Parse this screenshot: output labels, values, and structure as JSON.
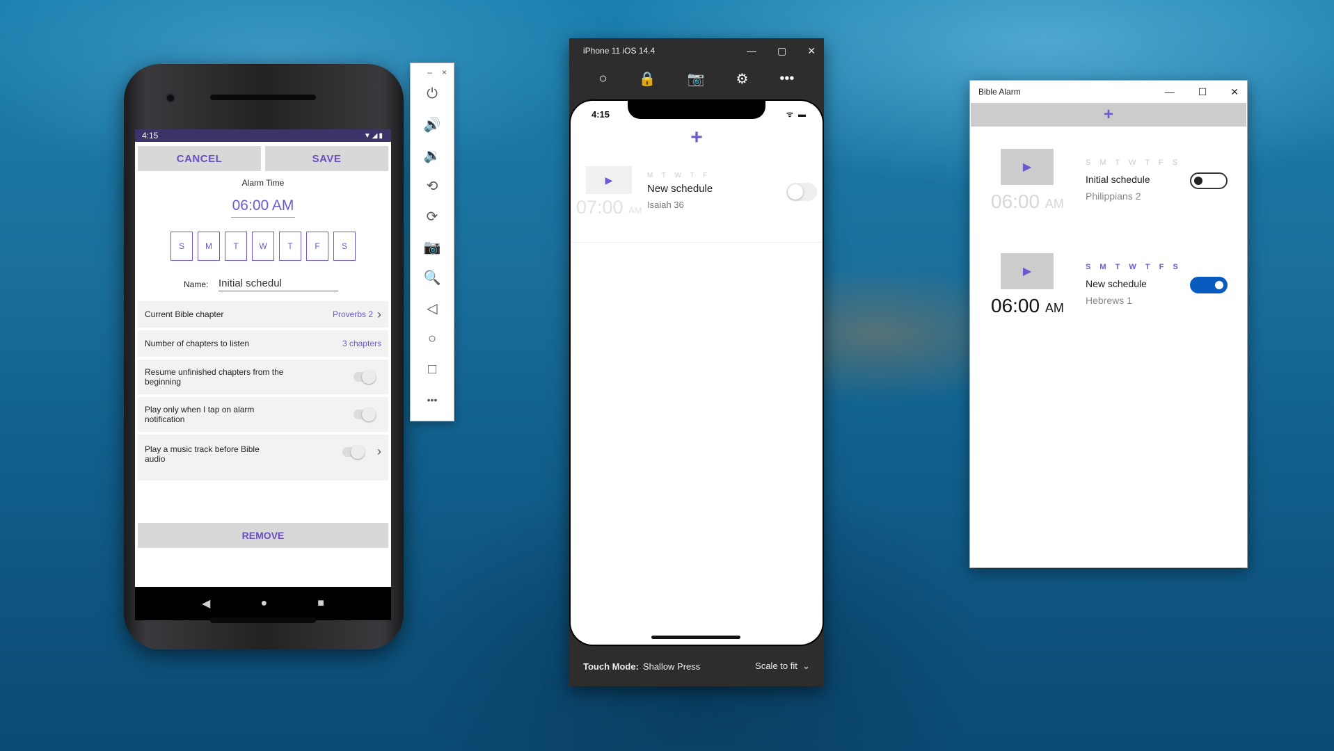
{
  "android": {
    "status_time": "4:15",
    "status_icons": "▼◢▮",
    "cancel_label": "CANCEL",
    "save_label": "SAVE",
    "alarm_time_label": "Alarm Time",
    "alarm_time": "06:00 AM",
    "days": [
      "S",
      "M",
      "T",
      "W",
      "T",
      "F",
      "S"
    ],
    "name_label": "Name:",
    "name_value": "Initial schedul",
    "rows": {
      "current_chapter_label": "Current Bible chapter",
      "current_chapter_value": "Proverbs 2",
      "chapters_count_label": "Number of chapters to listen",
      "chapters_count_value": "3 chapters",
      "resume_label": "Resume unfinished chapters from the beginning",
      "play_on_tap_label": "Play only when I tap on alarm notification",
      "music_track_label": "Play a music track before Bible audio"
    },
    "remove_label": "REMOVE",
    "nav": {
      "back": "◀",
      "home": "●",
      "recents": "■"
    }
  },
  "emulator_toolbar": {
    "minimize": "–",
    "close": "×",
    "icons": [
      "⏻",
      "🔊",
      "🔉",
      "⟲",
      "⟳",
      "📷",
      "🔍",
      "◁",
      "○",
      "□",
      "•••"
    ]
  },
  "ios": {
    "window_title": "iPhone 11 iOS 14.4",
    "window_min": "—",
    "window_max": "▢",
    "window_close": "✕",
    "tools": [
      "○",
      "🔒",
      "📷",
      "⚙",
      "•••"
    ],
    "status_time": "4:15",
    "status_right": "ᯤ ▬",
    "add": "+",
    "item": {
      "play": "▶",
      "days": "M T W T F",
      "name": "New schedule",
      "chapter": "Isaiah 36",
      "time": "07:00",
      "ampm": "AM"
    },
    "touch_mode_label": "Touch Mode:",
    "touch_mode_value": "Shallow Press",
    "scale": "Scale to fit",
    "scale_chevron": "⌄"
  },
  "windows_app": {
    "title": "Bible Alarm",
    "min": "—",
    "max": "☐",
    "close": "✕",
    "add": "+",
    "alarms": [
      {
        "play": "▶",
        "days": "S M T W T F S",
        "name": "Initial schedule",
        "chapter": "Philippians 2",
        "time": "06:00",
        "ampm": "AM",
        "enabled": false
      },
      {
        "play": "▶",
        "days": "S M T W T F S",
        "name": "New schedule",
        "chapter": "Hebrews 1",
        "time": "06:00",
        "ampm": "AM",
        "enabled": true
      }
    ]
  },
  "colors": {
    "accent": "#6a5acd",
    "android_statusbar": "#3a3468",
    "win_toggle_on": "#0a5bbf"
  }
}
